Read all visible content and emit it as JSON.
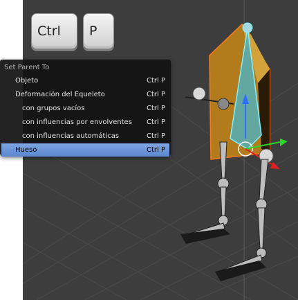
{
  "keys": {
    "ctrl": "Ctrl",
    "p": "P"
  },
  "menu": {
    "title": "Set Parent To",
    "items": [
      {
        "label": "Objeto",
        "shortcut": "Ctrl P",
        "indent": 0
      },
      {
        "label": "Deformación del Equeleto",
        "shortcut": "Ctrl P",
        "indent": 0
      },
      {
        "label": "con grupos vacíos",
        "shortcut": "Ctrl P",
        "indent": 1
      },
      {
        "label": "con influencias por envolventes",
        "shortcut": "Ctrl P",
        "indent": 1
      },
      {
        "label": "con influencias automáticas",
        "shortcut": "Ctrl P",
        "indent": 1
      },
      {
        "label": "Hueso",
        "shortcut": "Ctrl P",
        "indent": 0,
        "active": true
      }
    ]
  },
  "colors": {
    "viewport_bg": "#3d3d3d",
    "highlight": "#6b93d6",
    "armature": "#e4b13a",
    "selection": "#ff7a1a"
  }
}
